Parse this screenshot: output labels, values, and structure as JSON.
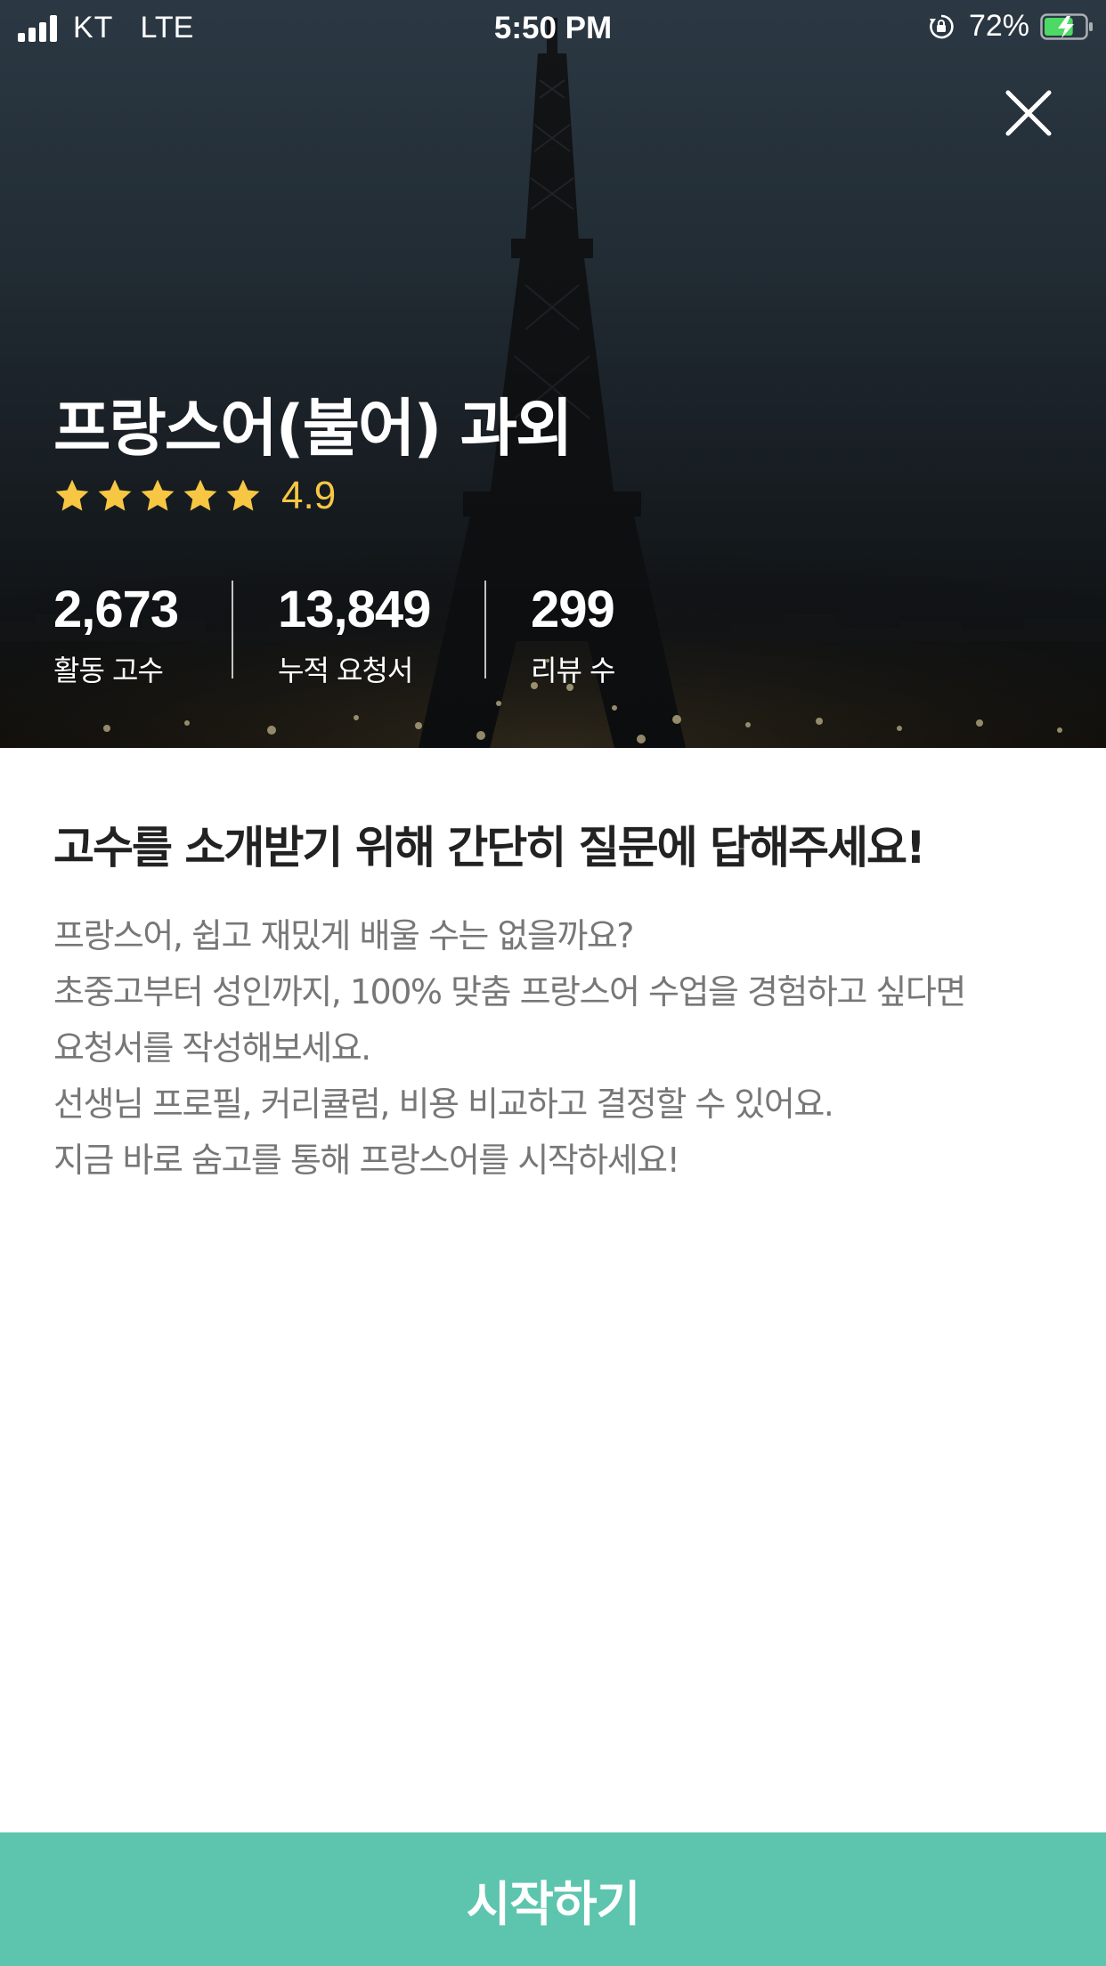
{
  "status_bar": {
    "carrier": "KT",
    "network": "LTE",
    "time": "5:50 PM",
    "battery": "72%",
    "battery_level": 0.72,
    "icons": [
      "signal-icon",
      "orientation-lock-icon",
      "battery-charging-icon"
    ]
  },
  "hero": {
    "title": "프랑스어(불어) 과외",
    "rating": {
      "stars": 5,
      "score": "4.9",
      "star_color": "#f7c744"
    },
    "stats": [
      {
        "value": "2,673",
        "label": "활동 고수"
      },
      {
        "value": "13,849",
        "label": "누적 요청서"
      },
      {
        "value": "299",
        "label": "리뷰 수"
      }
    ]
  },
  "content": {
    "heading": "고수를 소개받기 위해 간단히 질문에 답해주세요!",
    "paragraphs": [
      "프랑스어, 쉽고 재밌게 배울 수는 없을까요?",
      "초중고부터 성인까지, 100% 맞춤 프랑스어 수업을 경험하고 싶다면",
      "요청서를 작성해보세요.",
      "선생님 프로필, 커리큘럼, 비용 비교하고 결정할 수 있어요.",
      "지금 바로 숨고를 통해 프랑스어를 시작하세요!"
    ]
  },
  "cta": {
    "label": "시작하기",
    "color": "#5dc5ad"
  },
  "icons": {
    "close": "close-icon",
    "star": "star-icon"
  }
}
